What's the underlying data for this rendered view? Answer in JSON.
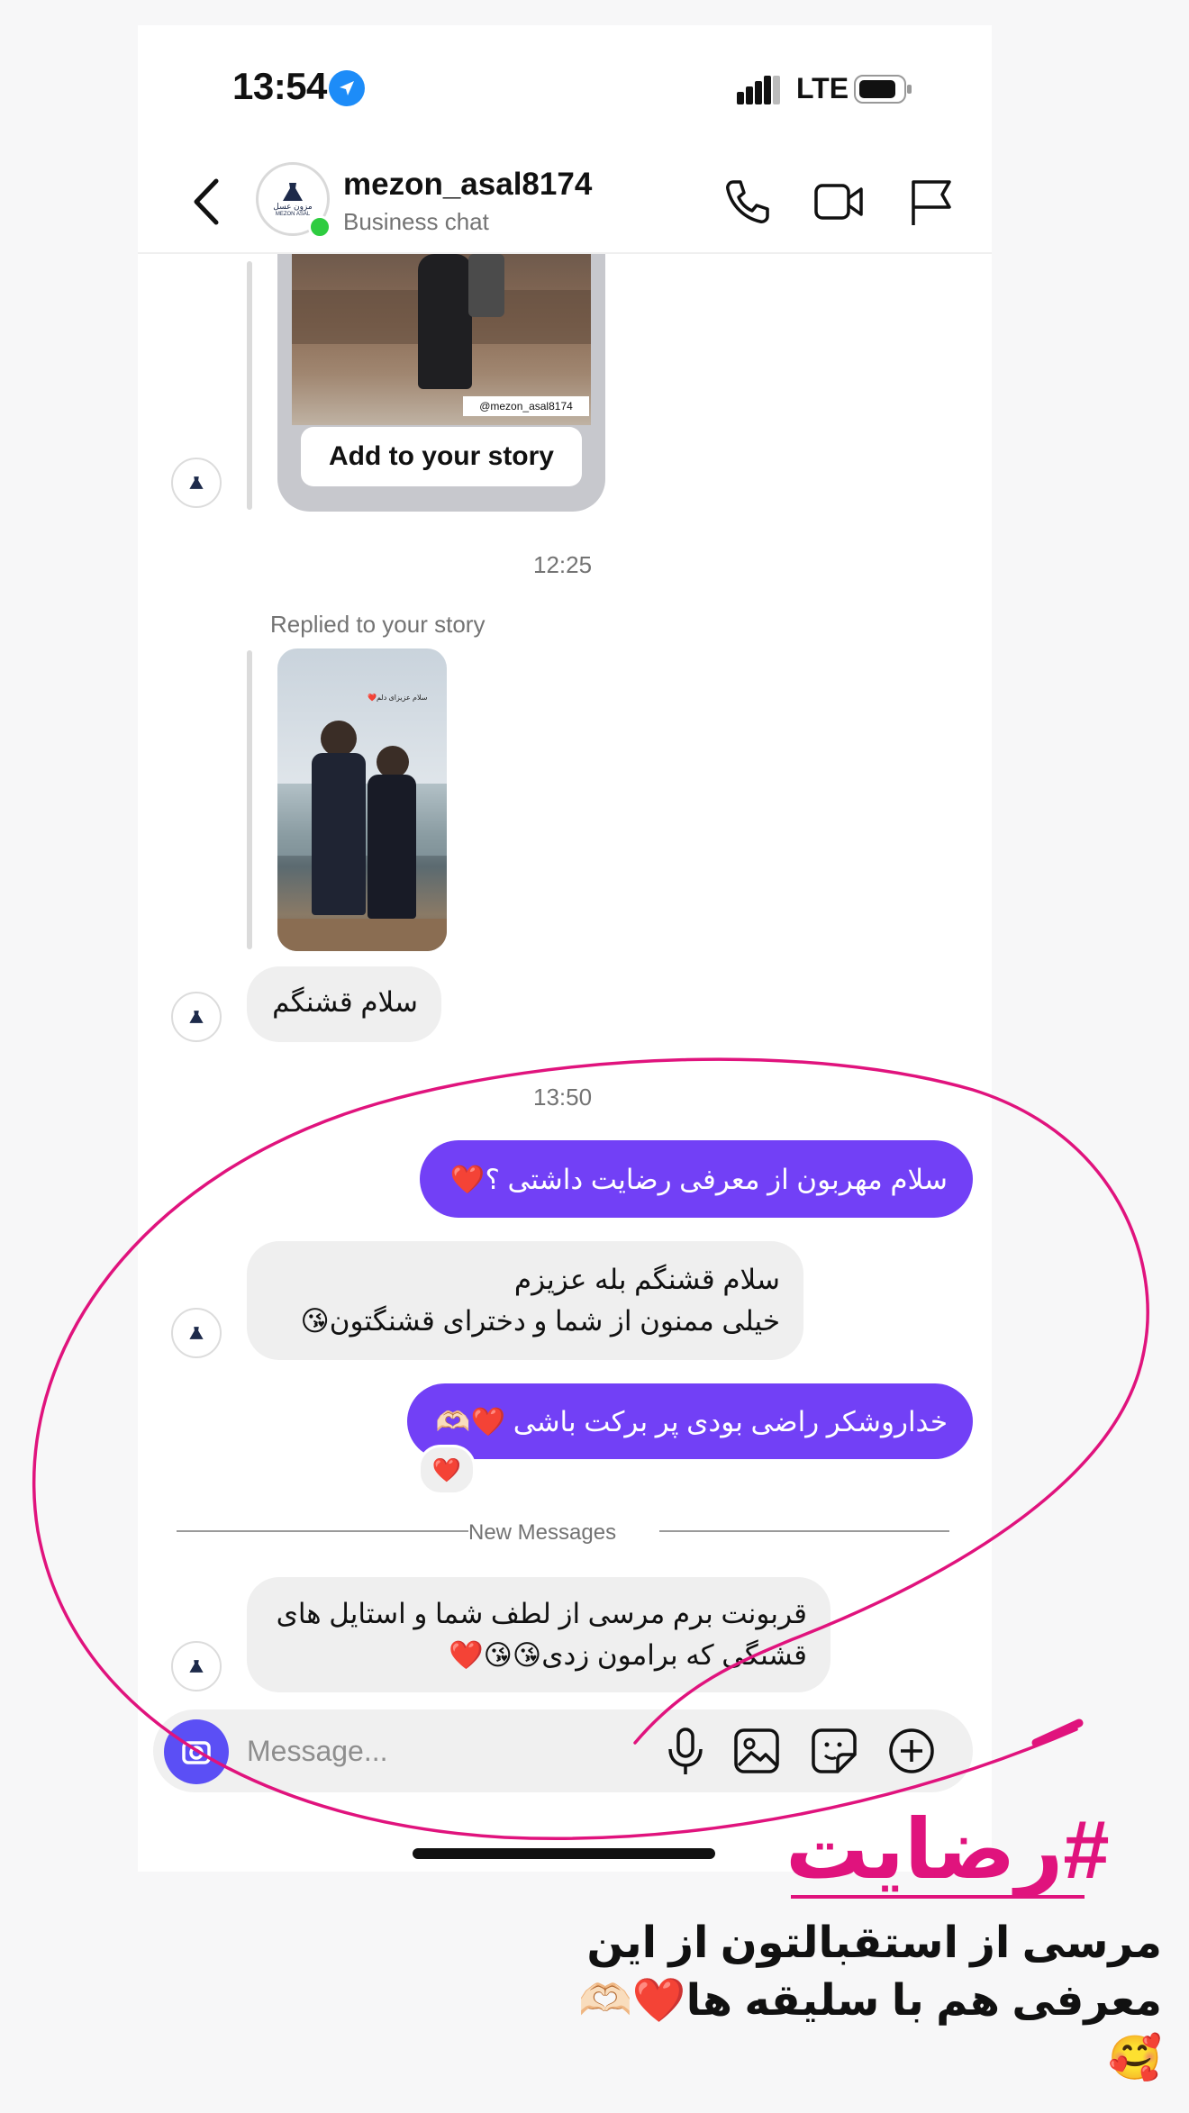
{
  "status_bar": {
    "time": "13:54",
    "network": "LTE"
  },
  "header": {
    "username": "mezon_asal8174",
    "subtitle": "Business chat"
  },
  "avatar_logo": {
    "line1": "مزون عسل",
    "line2": "MEZON ASAL"
  },
  "story_card": {
    "handle": "@mezon_asal8174",
    "add_to_story_label": "Add to your story"
  },
  "timestamps": [
    "12:25",
    "13:50"
  ],
  "reply_label": "Replied to your story",
  "story2_overlay": "سلام عزیزای دلم❤️",
  "messages": [
    {
      "id": "m1",
      "side": "in",
      "text": "سلام قشنگم"
    },
    {
      "id": "m2",
      "side": "out",
      "text": "سلام مهربون از معرفی رضایت داشتی ؟❤️"
    },
    {
      "id": "m3",
      "side": "in",
      "line1": "سلام قشنگم بله عزیزم",
      "line2": "خیلی ممنون از شما و دخترای قشنگتون😘"
    },
    {
      "id": "m4",
      "side": "out",
      "text": "خداروشکر راضی بودی پر برکت باشی ❤️🫶🏻",
      "reaction": "❤️"
    },
    {
      "id": "m5",
      "side": "in",
      "line1": "قربونت برم مرسی از لطف شما و استایل های",
      "line2": "قشنگی که برامون زدی😘😘❤️"
    }
  ],
  "new_messages_label": "New Messages",
  "composer": {
    "placeholder": "Message..."
  },
  "overlay": {
    "hashtag": "#رضایت",
    "caption_line1": "مرسی از استقبالتون از این",
    "caption_line2": "معرفی هم با سلیقه ها❤️🫶🏻🥰"
  },
  "colors": {
    "accent_purple": "#7240f6",
    "annotation_pink": "#e0137d",
    "online_green": "#2ecc40",
    "location_blue": "#1d8cf8"
  },
  "icons": [
    "back-icon",
    "phone-icon",
    "video-icon",
    "flag-icon",
    "camera-icon",
    "mic-icon",
    "gallery-icon",
    "sticker-icon",
    "plus-icon",
    "location-arrow-icon"
  ]
}
